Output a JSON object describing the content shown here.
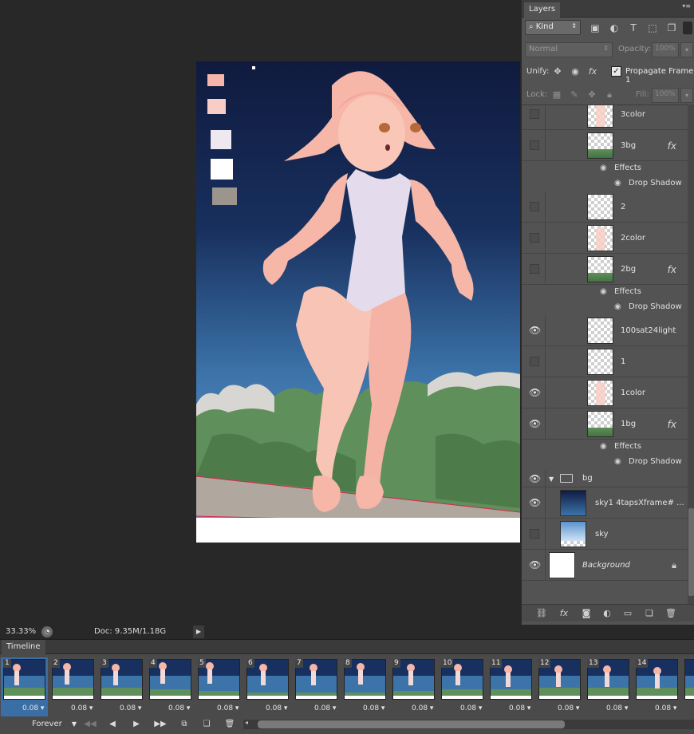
{
  "document": {
    "zoom": "33.33%",
    "doc_size": "Doc: 9.35M/1.18G",
    "canvas_swatch_colors": [
      "#f5b5ab",
      "#f8cdc6",
      "#eee8f1",
      "#ffffff",
      "#9c958e"
    ]
  },
  "layers_panel": {
    "title": "Layers",
    "filter_kind": "Kind",
    "blend_mode": "Normal",
    "opacity_label": "Opacity:",
    "opacity_value": "100%",
    "unify_label": "Unify:",
    "propagate_label": "Propagate Frame 1",
    "propagate_checked": true,
    "lock_label": "Lock:",
    "fill_label": "Fill:",
    "fill_value": "100%",
    "layers": [
      {
        "name": "3color",
        "visible": false,
        "thumb": "figure"
      },
      {
        "name": "3bg",
        "visible": false,
        "thumb": "bushes",
        "fx": "fx",
        "effects_label": "Effects",
        "effect_name": "Drop Shadow"
      },
      {
        "name": "2",
        "visible": false,
        "thumb": "empty"
      },
      {
        "name": "2color",
        "visible": false,
        "thumb": "figure"
      },
      {
        "name": "2bg",
        "visible": false,
        "thumb": "bushes",
        "fx": "fx",
        "effects_label": "Effects",
        "effect_name": "Drop Shadow"
      },
      {
        "name": "100sat24light",
        "visible": true,
        "thumb": "empty"
      },
      {
        "name": "1",
        "visible": false,
        "thumb": "empty"
      },
      {
        "name": "1color",
        "visible": true,
        "thumb": "figure"
      },
      {
        "name": "1bg",
        "visible": true,
        "thumb": "bushes",
        "fx": "fx",
        "effects_label": "Effects",
        "effect_name": "Drop Shadow"
      }
    ],
    "group": {
      "name": "bg",
      "visible": true,
      "expanded": true
    },
    "group_layers": [
      {
        "name": "sky1 4tapsXframe# ...",
        "visible": true,
        "thumb": "nightsky"
      },
      {
        "name": "sky",
        "visible": false,
        "thumb": "daysky"
      }
    ],
    "background_layer": {
      "name": "Background",
      "visible": true,
      "locked": true
    }
  },
  "timeline": {
    "title": "Timeline",
    "loop_option": "Forever",
    "frames": [
      {
        "num": "1",
        "delay": "0.08"
      },
      {
        "num": "2",
        "delay": "0.08"
      },
      {
        "num": "3",
        "delay": "0.08"
      },
      {
        "num": "4",
        "delay": "0.08"
      },
      {
        "num": "5",
        "delay": "0.08"
      },
      {
        "num": "6",
        "delay": "0.08"
      },
      {
        "num": "7",
        "delay": "0.08"
      },
      {
        "num": "8",
        "delay": "0.08"
      },
      {
        "num": "9",
        "delay": "0.08"
      },
      {
        "num": "10",
        "delay": "0.08"
      },
      {
        "num": "11",
        "delay": "0.08"
      },
      {
        "num": "12",
        "delay": "0.08"
      },
      {
        "num": "13",
        "delay": "0.08"
      },
      {
        "num": "14",
        "delay": "0.08"
      },
      {
        "num": "",
        "delay": ""
      }
    ],
    "selected_frame": "1"
  }
}
